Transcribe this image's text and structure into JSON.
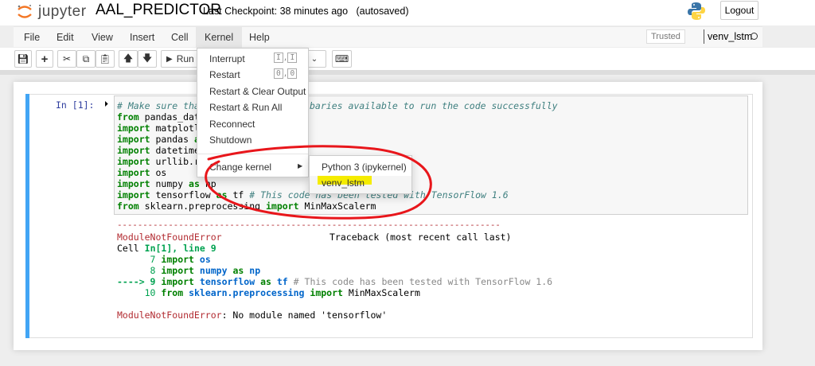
{
  "header": {
    "logo_text": "jupyter",
    "notebook_name": "AAL_PREDICTOR",
    "checkpoint": "Last Checkpoint: 38 minutes ago",
    "autosave": "(autosaved)",
    "logout": "Logout"
  },
  "menubar": {
    "items": [
      "File",
      "Edit",
      "View",
      "Insert",
      "Cell",
      "Kernel",
      "Help"
    ],
    "trusted": "Trusted",
    "kernel_name": "venv_lstm"
  },
  "toolbar": {
    "run": "Run"
  },
  "cell": {
    "prompt": "In [1]:",
    "code": {
      "l1a": "# Make sure that",
      "l1b": "baries available to run the code successfully",
      "l2": "pandas_data",
      "l3": "matplotli",
      "l4": "pandas",
      "l4as": "as",
      "l5": "datetime",
      "l6": "urllib.re",
      "l7": "os",
      "l8": "numpy",
      "l8b": "np",
      "l9": "tensorflow",
      "l9b": "tf",
      "l9c": "# This code has been tested with TensorFlow 1.6",
      "l10": "sklearn.preprocessing",
      "l10b": "MinMaxScalerm",
      "from": "from",
      "import": "import",
      "as": "as"
    },
    "output": {
      "dashes": "---------------------------------------------------------------------------",
      "err": "ModuleNotFoundError",
      "tb": "Traceback (most recent call last)",
      "cell": "Cell",
      "loc": "In[1], line 9",
      "n7": "7",
      "n8": "8",
      "arrow": "----> 9",
      "n10": "10",
      "os": "os",
      "numpy": "numpy",
      "np": "np",
      "tensorflow": "tensorflow",
      "tf": "tf",
      "comment": "# This code has been tested with TensorFlow 1.6",
      "sklearn": "sklearn.preprocessing",
      "scaler": "MinMaxScalerm",
      "msg": ": No module named 'tensorflow'"
    }
  },
  "kernel_menu": {
    "items": [
      "Interrupt",
      "Restart",
      "Restart & Clear Output",
      "Restart & Run All",
      "Reconnect",
      "Shutdown"
    ],
    "interrupt_keys": [
      "I",
      "I"
    ],
    "restart_keys": [
      "0",
      "0"
    ],
    "change_kernel": "Change kernel",
    "submenu": [
      "Python 3 (ipykernel)",
      "venv_lstm"
    ]
  },
  "colors": {
    "annotation": "#e8161b",
    "highlight": "#f5ec00",
    "cell_selected": "#42a5f5"
  }
}
